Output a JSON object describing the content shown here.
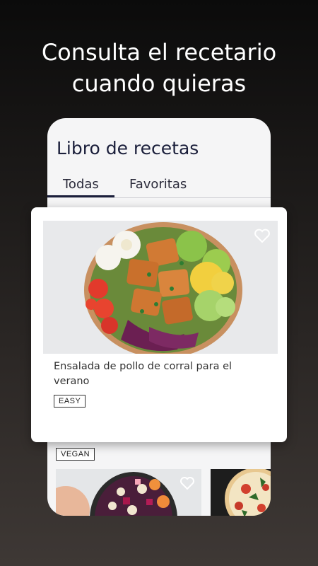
{
  "headline": {
    "line1": "Consulta el recetario",
    "line2": "cuando quieras"
  },
  "book": {
    "title": "Libro de recetas",
    "tabs": [
      {
        "label": "Todas",
        "active": true
      },
      {
        "label": "Favoritas",
        "active": false
      }
    ]
  },
  "featured": {
    "title": "Ensalada de pollo de corral para el verano",
    "tag": "EASY",
    "icon": "heart-outline-icon"
  },
  "list": {
    "tag": "VEGAN",
    "icon": "heart-outline-icon"
  },
  "colors": {
    "accent": "#1b1f3b",
    "background_top": "#0b0b0b",
    "background_bottom": "#3e3835"
  }
}
